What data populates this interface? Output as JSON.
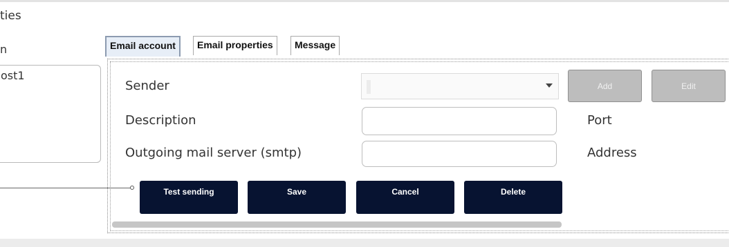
{
  "header": {
    "title_fragment": "ties",
    "label_fragment": "n"
  },
  "left_list": {
    "items": [
      "ost1"
    ]
  },
  "tabs": [
    {
      "label": "Email account",
      "active": true
    },
    {
      "label": "Email properties",
      "active": false
    },
    {
      "label": "Message",
      "active": false
    }
  ],
  "form": {
    "sender_label": "Sender",
    "sender_value": "",
    "description_label": "Description",
    "description_value": "",
    "smtp_label": "Outgoing mail server (smtp)",
    "smtp_value": "",
    "port_label": "Port",
    "address_label": "Address"
  },
  "side_buttons": {
    "add": "Add",
    "edit": "Edit"
  },
  "actions": {
    "test_sending": "Test sending",
    "save": "Save",
    "cancel": "Cancel",
    "delete": "Delete"
  },
  "colors": {
    "action_button": "#071331",
    "disabled_button": "#bdbdbd",
    "active_tab": "#e7eef7"
  }
}
